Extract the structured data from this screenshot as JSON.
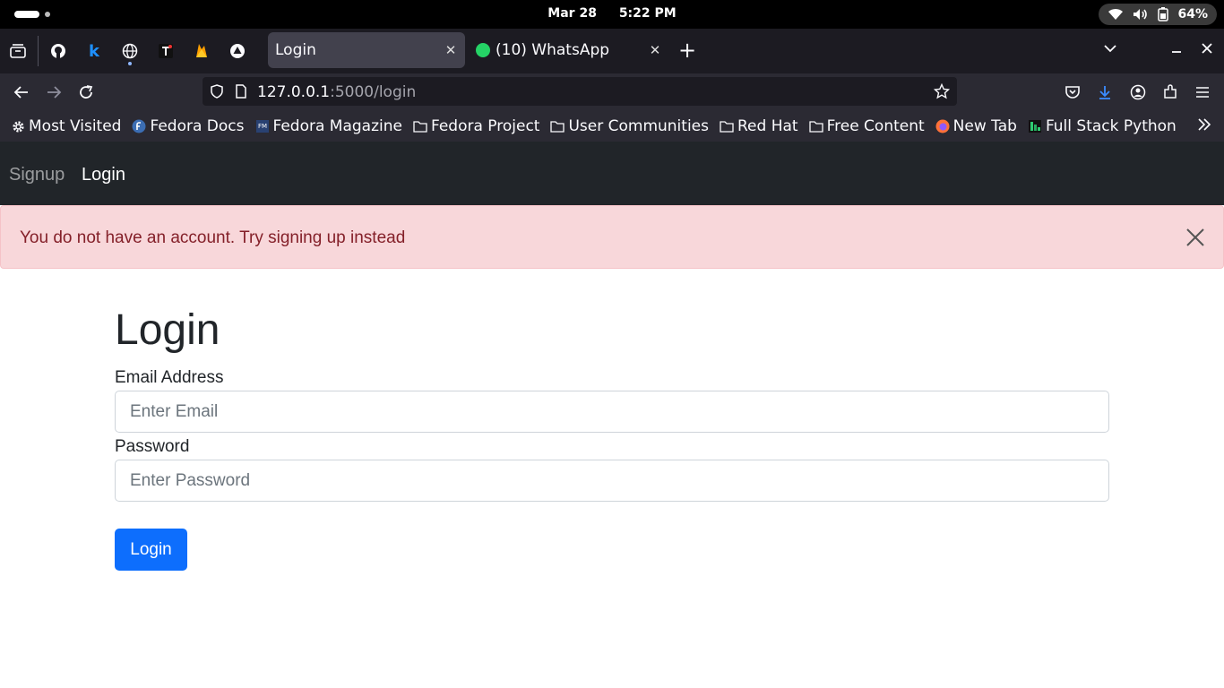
{
  "system": {
    "date": "Mar 28",
    "time": "5:22 PM",
    "battery": "64%"
  },
  "browser": {
    "tabs": [
      {
        "label": "Login",
        "active": true
      },
      {
        "label": "(10) WhatsApp",
        "active": false
      }
    ],
    "url": {
      "host": "127.0.0.1",
      "rest": ":5000/login"
    },
    "bookmarks": [
      {
        "label": "Most Visited",
        "icon": "gear-icon"
      },
      {
        "label": "Fedora Docs",
        "icon": "fedora-icon"
      },
      {
        "label": "Fedora Magazine",
        "icon": "fedora-magazine-icon"
      },
      {
        "label": "Fedora Project",
        "icon": "folder-icon"
      },
      {
        "label": "User Communities",
        "icon": "folder-icon"
      },
      {
        "label": "Red Hat",
        "icon": "folder-icon"
      },
      {
        "label": "Free Content",
        "icon": "folder-icon"
      },
      {
        "label": "New Tab",
        "icon": "firefox-icon"
      },
      {
        "label": "Full Stack Python",
        "icon": "fullstackpython-icon"
      }
    ]
  },
  "site": {
    "nav": {
      "signup": "Signup",
      "login": "Login"
    },
    "alert": {
      "message": "You do not have an account. Try signing up instead"
    },
    "form": {
      "title": "Login",
      "email_label": "Email Address",
      "email_placeholder": "Enter Email",
      "password_label": "Password",
      "password_placeholder": "Enter Password",
      "submit": "Login"
    }
  },
  "colors": {
    "navbar": "#212529",
    "alert_bg": "#f8d7da",
    "alert_text": "#842029",
    "primary": "#0d6efd"
  }
}
